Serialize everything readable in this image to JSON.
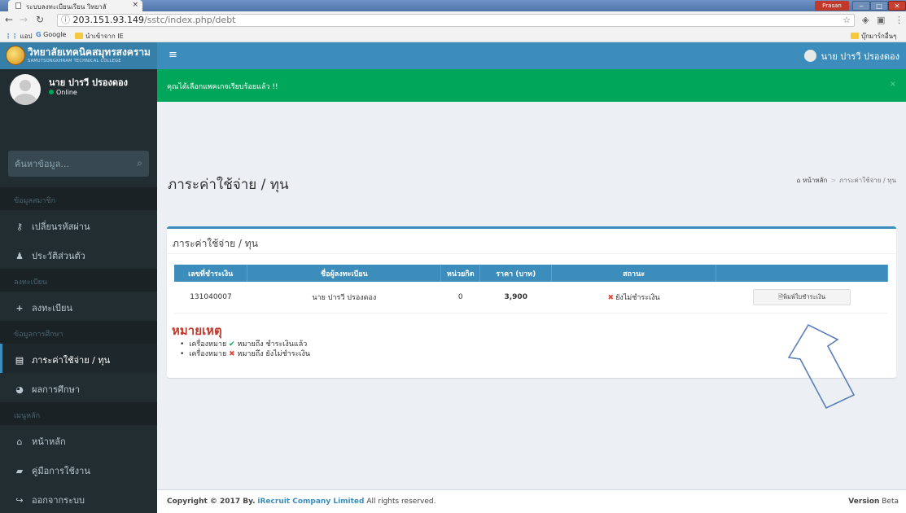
{
  "browser": {
    "tab_title": "ระบบลงทะเบียนเรียน วิทยาลั",
    "tab_close": "×",
    "profile_name": "Prasan",
    "win_min": "‒",
    "win_max": "□",
    "win_close": "✕",
    "url_host": "203.151.93.149",
    "url_path": "/sstc/index.php/debt",
    "bookmarks": {
      "apps": "แอป",
      "google": "Google",
      "imported": "นำเข้าจาก IE",
      "other": "บุ๊กมาร์กอื่นๆ"
    }
  },
  "header": {
    "logo_title": "วิทยาลัยเทคนิคสมุทรสงคราม",
    "logo_subtitle": "SAMUTSONGKHRAM TECHNICAL COLLEGE",
    "menu_toggle": "≡",
    "user_name": "นาย ปารวี ปรองดอง"
  },
  "sidebar": {
    "user_name": "นาย ปารวี ปรองดอง",
    "status": "Online",
    "search_placeholder": "ค้นหาข้อมูล...",
    "sections": {
      "member": "ข้อมูลสมาชิก",
      "register": "ลงทะเบียน",
      "study": "ข้อมูลการศึกษา",
      "main_menu": "เมนูหลัก"
    },
    "items": {
      "change_password": "เปลี่ยนรหัสผ่าน",
      "profile": "ประวัติส่วนตัว",
      "register": "ลงทะเบียน",
      "expenses": "ภาระค่าใช้จ่าย / ทุน",
      "results": "ผลการศึกษา",
      "home": "หน้าหลัก",
      "manual": "คู่มือการใช้งาน",
      "logout": "ออกจากระบบ"
    }
  },
  "main": {
    "alert_text": "คุณได้เลือกแพคเกจเรียบร้อยแล้ว !!",
    "alert_close": "×",
    "page_title": "ภาระค่าใช้จ่าย / ทุน",
    "breadcrumb_home": "หน้าหลัก",
    "breadcrumb_sep": ">",
    "breadcrumb_current": "ภาระค่าใช้จ่าย / ทุน",
    "box_title": "ภาระค่าใช้จ่าย / ทุน",
    "table": {
      "headers": [
        "เลขที่ชำระเงิน",
        "ชื่อผู้ลงทะเบียน",
        "หน่วยกิต",
        "ราคา (บาท)",
        "สถานะ",
        ""
      ],
      "row": {
        "receipt": "131040007",
        "name": "นาย ปารวี ปรองดอง",
        "credits": "0",
        "price": "3,900",
        "status_mark": "✖",
        "status": "ยังไม่ชำระเงิน",
        "print_button": "พิมพ์ใบชำระเงิน"
      }
    },
    "note_title": "หมายเหตุ",
    "note_1_prefix": "เครื่องหมาย",
    "note_1_mark": "✔",
    "note_1_suffix": "หมายถึง ชำระเงินแล้ว",
    "note_2_prefix": "เครื่องหมาย",
    "note_2_mark": "✖",
    "note_2_suffix": "หมายถึง ยังไม่ชำระเงิน"
  },
  "footer": {
    "copyright_prefix": "Copyright © 2017 By.",
    "company": "iRecruit Company Limited",
    "rights": "All rights reserved.",
    "version_label": "Version",
    "version_value": "Beta"
  },
  "colors": {
    "primary": "#3c8dbc",
    "logo_bg": "#367fa9",
    "sidebar_bg": "#222d32",
    "alert_green": "#00a65a",
    "danger": "#dd4b39"
  }
}
